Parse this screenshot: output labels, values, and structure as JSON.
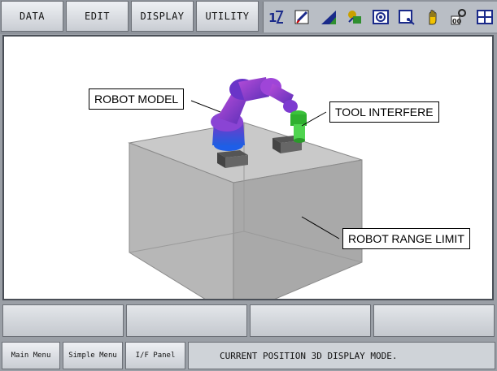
{
  "menu": {
    "items": [
      {
        "label": "DATA"
      },
      {
        "label": "EDIT"
      },
      {
        "label": "DISPLAY"
      },
      {
        "label": "UTILITY"
      }
    ]
  },
  "status_icons": [
    "axis-select-icon",
    "edit-mode-icon",
    "speed-level-icon",
    "robot-coord-icon",
    "servo-icon",
    "play-mode-icon",
    "hand-icon",
    "security-icon",
    "grid-menu-icon"
  ],
  "viewport": {
    "callouts": {
      "robot_model": "ROBOT MODEL",
      "tool_interfere": "TOOL INTERFERE",
      "range_limit": "ROBOT RANGE LIMIT"
    }
  },
  "bottom": {
    "main_menu": "Main Menu",
    "simple_menu": "Simple Menu",
    "if_panel": "I/F Panel",
    "message": "CURRENT POSITION 3D DISPLAY MODE."
  }
}
